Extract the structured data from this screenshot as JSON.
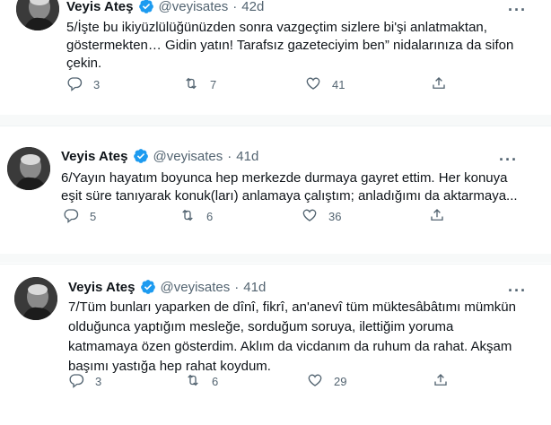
{
  "tweets": [
    {
      "name": "Veyis Ateş",
      "handle": "@veyisates",
      "dot": "·",
      "time": "42d",
      "text": "5/İşte bu ikiyüzlülüğünüzden sonra vazgeçtim sizlere bi'şi anlatmaktan, göstermekten… Gidin yatın! Tarafsız gazeteciyim ben” nidalarınıza da sifon çekin.",
      "replies": "3",
      "retweets": "7",
      "likes": "41"
    },
    {
      "name": "Veyis Ateş",
      "handle": "@veyisates",
      "dot": "·",
      "time": "41d",
      "text": "6/Yayın hayatım boyunca hep merkezde durmaya gayret ettim. Her konuya eşit süre tanıyarak konuk(ları) anlamaya çalıştım; anladığımı da aktarmaya...",
      "replies": "5",
      "retweets": "6",
      "likes": "36"
    },
    {
      "name": "Veyis Ateş",
      "handle": "@veyisates",
      "dot": "·",
      "time": "41d",
      "text": "7/Tüm bunları yaparken de dînî, fikrî, an'anevî tüm müktesâbâtımı mümkün olduğunca yaptığım mesleğe, sorduğum soruya, ilettiğim yoruma katmamaya özen gösterdim. Aklım da vicdanım da ruhum da rahat. Akşam başımı yastığa hep rahat koydum.",
      "replies": "3",
      "retweets": "6",
      "likes": "29"
    }
  ],
  "icons": {
    "verified": "verified-badge-icon",
    "more": "more-icon",
    "reply": "reply-icon",
    "retweet": "retweet-icon",
    "like": "like-icon",
    "share": "share-icon"
  },
  "colors": {
    "verified": "#1d9bf0",
    "secondary_text": "#536471",
    "divider": "#f7f9f9"
  }
}
